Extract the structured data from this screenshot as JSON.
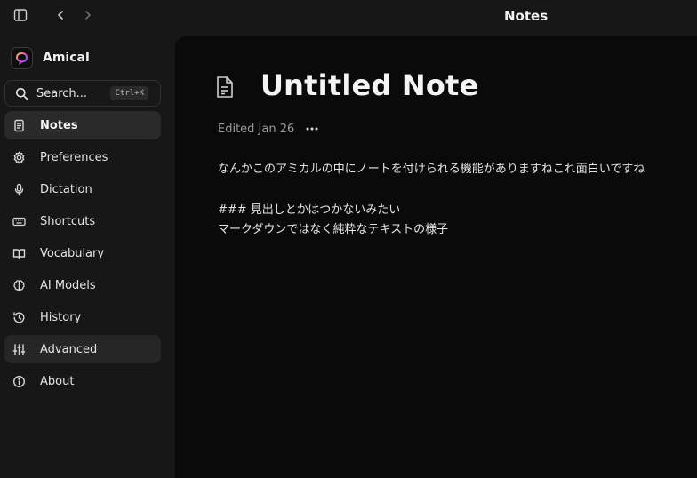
{
  "titlebar": {
    "app_title": "Notes",
    "sidebar_toggle_icon": "sidebar-panel-icon",
    "back_icon": "chevron-left-icon",
    "forward_icon": "chevron-right-icon"
  },
  "brand": {
    "name": "Amical",
    "logo_icon": "amical-logo-icon"
  },
  "search": {
    "label": "Search...",
    "shortcut": "Ctrl+K",
    "icon": "search-icon"
  },
  "sidebar": {
    "items": [
      {
        "label": "Notes",
        "icon": "document-icon",
        "active": true
      },
      {
        "label": "Preferences",
        "icon": "gear-icon"
      },
      {
        "label": "Dictation",
        "icon": "microphone-icon"
      },
      {
        "label": "Shortcuts",
        "icon": "keyboard-icon"
      },
      {
        "label": "Vocabulary",
        "icon": "book-icon"
      },
      {
        "label": "AI Models",
        "icon": "brain-icon"
      },
      {
        "label": "History",
        "icon": "history-icon"
      },
      {
        "label": "Advanced",
        "icon": "sliders-icon"
      },
      {
        "label": "About",
        "icon": "info-icon"
      }
    ]
  },
  "note": {
    "title": "Untitled Note",
    "edited": "Edited Jan 26",
    "more_icon": "more-horizontal-icon",
    "lines": [
      "なんかこのアミカルの中にノートを付けられる機能がありますねこれ面白いですね",
      "### 見出しとかはつかないみたい",
      "マークダウンではなく純粋なテキストの様子"
    ]
  }
}
